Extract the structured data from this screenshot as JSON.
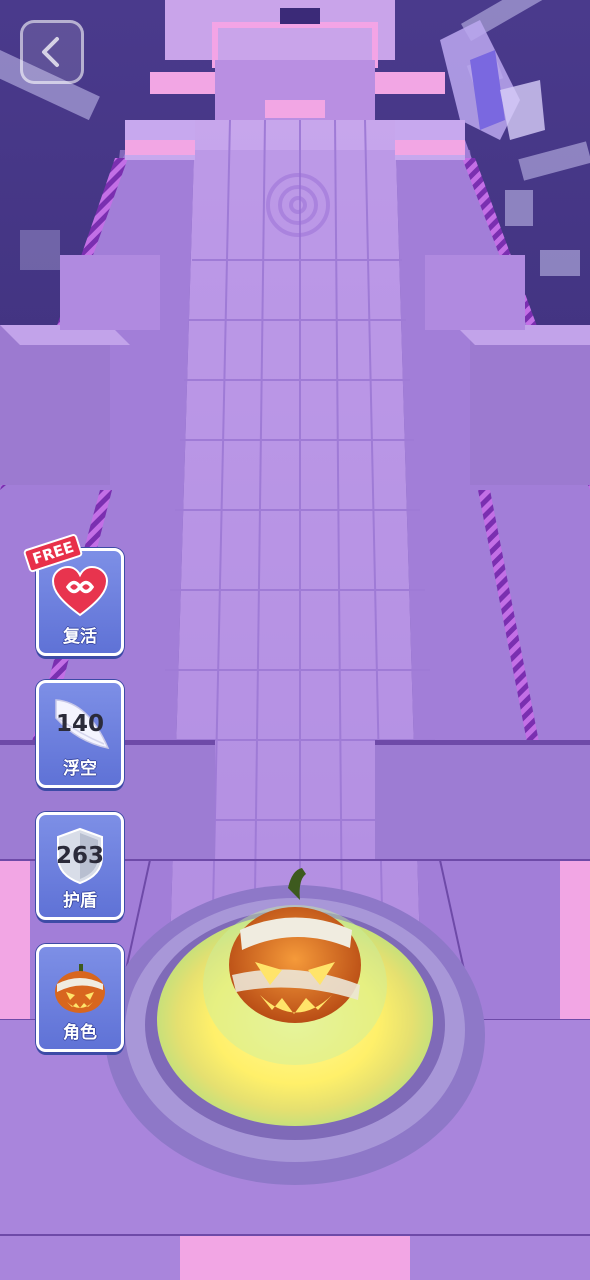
{
  "back_button": {
    "icon": "chevron-left-icon"
  },
  "powerups": {
    "revive": {
      "badge": "FREE",
      "label": "复活",
      "icon": "infinity-heart-icon"
    },
    "float": {
      "count": "140",
      "label": "浮空",
      "icon": "wing-icon"
    },
    "shield": {
      "count": "263",
      "label": "护盾",
      "icon": "shield-icon"
    },
    "character": {
      "label": "角色",
      "icon": "pumpkin-icon"
    }
  },
  "player": {
    "skin": "mummy pumpkin"
  },
  "colors": {
    "sky": "#3b2a78",
    "track": "#b892e0",
    "track_dark": "#9a78cf",
    "accent_pink": "#f0a6e0",
    "button_blue": "#6a7ede",
    "glow_yellow": "#fff47a"
  }
}
